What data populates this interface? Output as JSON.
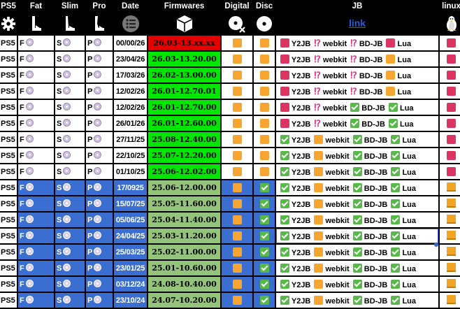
{
  "headers": [
    "PS5",
    "Fat",
    "Slim",
    "Pro",
    "Date",
    "Firmwares",
    "Digital",
    "Disc",
    "JB",
    "linux"
  ],
  "icon_row": {
    "settings_icon": "gear-icon",
    "fat_icon": "ps5-fat-console-icon",
    "slim_icon": "ps5-slim-console-icon",
    "pro_icon": "ps5-pro-console-icon",
    "date_icon": "list-menu-icon",
    "firmware_icon": "cube-icon",
    "digital_icon": "disc-crossed-icon",
    "disc_icon": "disc-icon",
    "jb_link": "link",
    "linux_icon": "tux-penguin-icon"
  },
  "rows": [
    {
      "ps": "PS5",
      "fat": "F",
      "slim": "S",
      "pro": "P",
      "date": "00/00/26",
      "fw": "26.03-13.xx.xx",
      "fw_color": "red",
      "style": "w",
      "digital": "orange",
      "disc": "orange",
      "jb": [
        "red",
        "exclaim",
        "exclaim",
        "red"
      ],
      "linux": "red"
    },
    {
      "ps": "PS5",
      "fat": "F",
      "slim": "S",
      "pro": "P",
      "date": "23/04/26",
      "fw": "26.03-13.20.00",
      "fw_color": "green",
      "style": "w",
      "digital": "orange",
      "disc": "orange",
      "jb": [
        "red",
        "exclaim",
        "exclaim",
        "orange"
      ],
      "linux": "red"
    },
    {
      "ps": "PS5",
      "fat": "F",
      "slim": "S",
      "pro": "P",
      "date": "17/03/26",
      "fw": "26.02-13.00.00",
      "fw_color": "green",
      "style": "w",
      "digital": "orange",
      "disc": "orange",
      "jb": [
        "red",
        "exclaim",
        "exclaim",
        "orange"
      ],
      "linux": "red"
    },
    {
      "ps": "PS5",
      "fat": "F",
      "slim": "S",
      "pro": "P",
      "date": "12/02/26",
      "fw": "26.01-12.70.01",
      "fw_color": "green",
      "style": "w",
      "digital": "orange",
      "disc": "orange",
      "jb": [
        "red",
        "exclaim",
        "exclaim",
        "orange"
      ],
      "linux": "red"
    },
    {
      "ps": "PS5",
      "fat": "F",
      "slim": "S",
      "pro": "P",
      "date": "12/02/26",
      "fw": "26.01-12.70.00",
      "fw_color": "green",
      "style": "w",
      "digital": "orange",
      "disc": "orange",
      "jb": [
        "red",
        "exclaim",
        "check",
        "check"
      ],
      "linux": "red"
    },
    {
      "ps": "PS5",
      "fat": "F",
      "slim": "S",
      "pro": "P",
      "date": "26/01/26",
      "fw": "26.01-12.60.00",
      "fw_color": "green",
      "style": "w",
      "digital": "orange",
      "disc": "orange",
      "jb": [
        "red",
        "exclaim",
        "check",
        "check"
      ],
      "linux": "red"
    },
    {
      "ps": "PS5",
      "fat": "F",
      "slim": "S",
      "pro": "P",
      "date": "27/11/25",
      "fw": "25.08-12.40.00",
      "fw_color": "green",
      "style": "w",
      "digital": "orange",
      "disc": "orange",
      "jb": [
        "check",
        "orange",
        "check",
        "check"
      ],
      "linux": "red"
    },
    {
      "ps": "PS5",
      "fat": "F",
      "slim": "S",
      "pro": "P",
      "date": "22/10/25",
      "fw": "25.07-12.20.00",
      "fw_color": "green",
      "style": "w",
      "digital": "orange",
      "disc": "orange",
      "jb": [
        "check",
        "orange",
        "check",
        "check"
      ],
      "linux": "red"
    },
    {
      "ps": "PS5",
      "fat": "F",
      "slim": "S",
      "pro": "P",
      "date": "01/10/25",
      "fw": "25.06-12.02.00",
      "fw_color": "green",
      "style": "w",
      "digital": "orange",
      "disc": "orange",
      "jb": [
        "check",
        "orange",
        "check",
        "check"
      ],
      "linux": "red"
    },
    {
      "ps": "PS5",
      "fat": "F",
      "slim": "S",
      "pro": "P",
      "date": "17/0925",
      "fw": "25.06-12.00.00",
      "fw_color": "olive",
      "style": "b",
      "digital": "orange",
      "disc": "check",
      "jb": [
        "check",
        "orange",
        "check",
        "check"
      ],
      "linux": "bar"
    },
    {
      "ps": "PS5",
      "fat": "F",
      "slim": "S",
      "pro": "P",
      "date": "15/07/25",
      "fw": "25.05-11.60.00",
      "fw_color": "olive",
      "style": "b",
      "digital": "orange",
      "disc": "check",
      "jb": [
        "check",
        "orange",
        "check",
        "check"
      ],
      "linux": "bar"
    },
    {
      "ps": "PS5",
      "fat": "F",
      "slim": "S",
      "pro": "P",
      "date": "05/06/25",
      "fw": "25.04-11.40.00",
      "fw_color": "olive",
      "style": "b",
      "digital": "orange",
      "disc": "check",
      "jb": [
        "check",
        "orange",
        "check",
        "check"
      ],
      "linux": "bar"
    },
    {
      "ps": "PS5",
      "fat": "F",
      "slim": "S",
      "pro": "P",
      "date": "24/04/25",
      "fw": "25.03-11.20.00",
      "fw_color": "olive",
      "style": "b",
      "digital": "orange",
      "disc": "check",
      "jb": [
        "check",
        "orange",
        "check",
        "check"
      ],
      "linux": "bar"
    },
    {
      "ps": "PS5",
      "fat": "F",
      "slim": "S",
      "pro": "P",
      "date": "25/03/25",
      "fw": "25.02-11.00.00",
      "fw_color": "olive",
      "style": "b",
      "digital": "orange",
      "disc": "check",
      "jb": [
        "check",
        "orange",
        "check",
        "check"
      ],
      "linux": "bar"
    },
    {
      "ps": "PS5",
      "fat": "F",
      "slim": "S",
      "pro": "P",
      "date": "23/01/25",
      "fw": "25.01-10.60.00",
      "fw_color": "olive",
      "style": "b",
      "digital": "orange",
      "disc": "check",
      "jb": [
        "check",
        "orange",
        "check",
        "check"
      ],
      "linux": "bar"
    },
    {
      "ps": "PS5",
      "fat": "F",
      "slim": "S",
      "pro": "P",
      "date": "03/12/24",
      "fw": "24.08-10.40.00",
      "fw_color": "olive",
      "style": "b",
      "digital": "orange",
      "disc": "check",
      "jb": [
        "check",
        "orange",
        "check",
        "check"
      ],
      "linux": "bar"
    },
    {
      "ps": "PS5",
      "fat": "F",
      "slim": "S",
      "pro": "P",
      "date": "23/10/24",
      "fw": "24.07-10.20.00",
      "fw_color": "olive",
      "style": "b",
      "digital": "orange",
      "disc": "check",
      "jb": [
        "check",
        "orange",
        "check",
        "check"
      ],
      "linux": "bar"
    }
  ],
  "jb_labels": [
    "Y2JB",
    "webkit",
    "BD-JB",
    "Lua"
  ],
  "colors": {
    "red": "#e50000",
    "green": "#00e600",
    "olive": "#94c47b",
    "blue": "#3a6fd1",
    "orange": "#f6a531",
    "pink": "#dc3563",
    "check": "#58b94a"
  }
}
